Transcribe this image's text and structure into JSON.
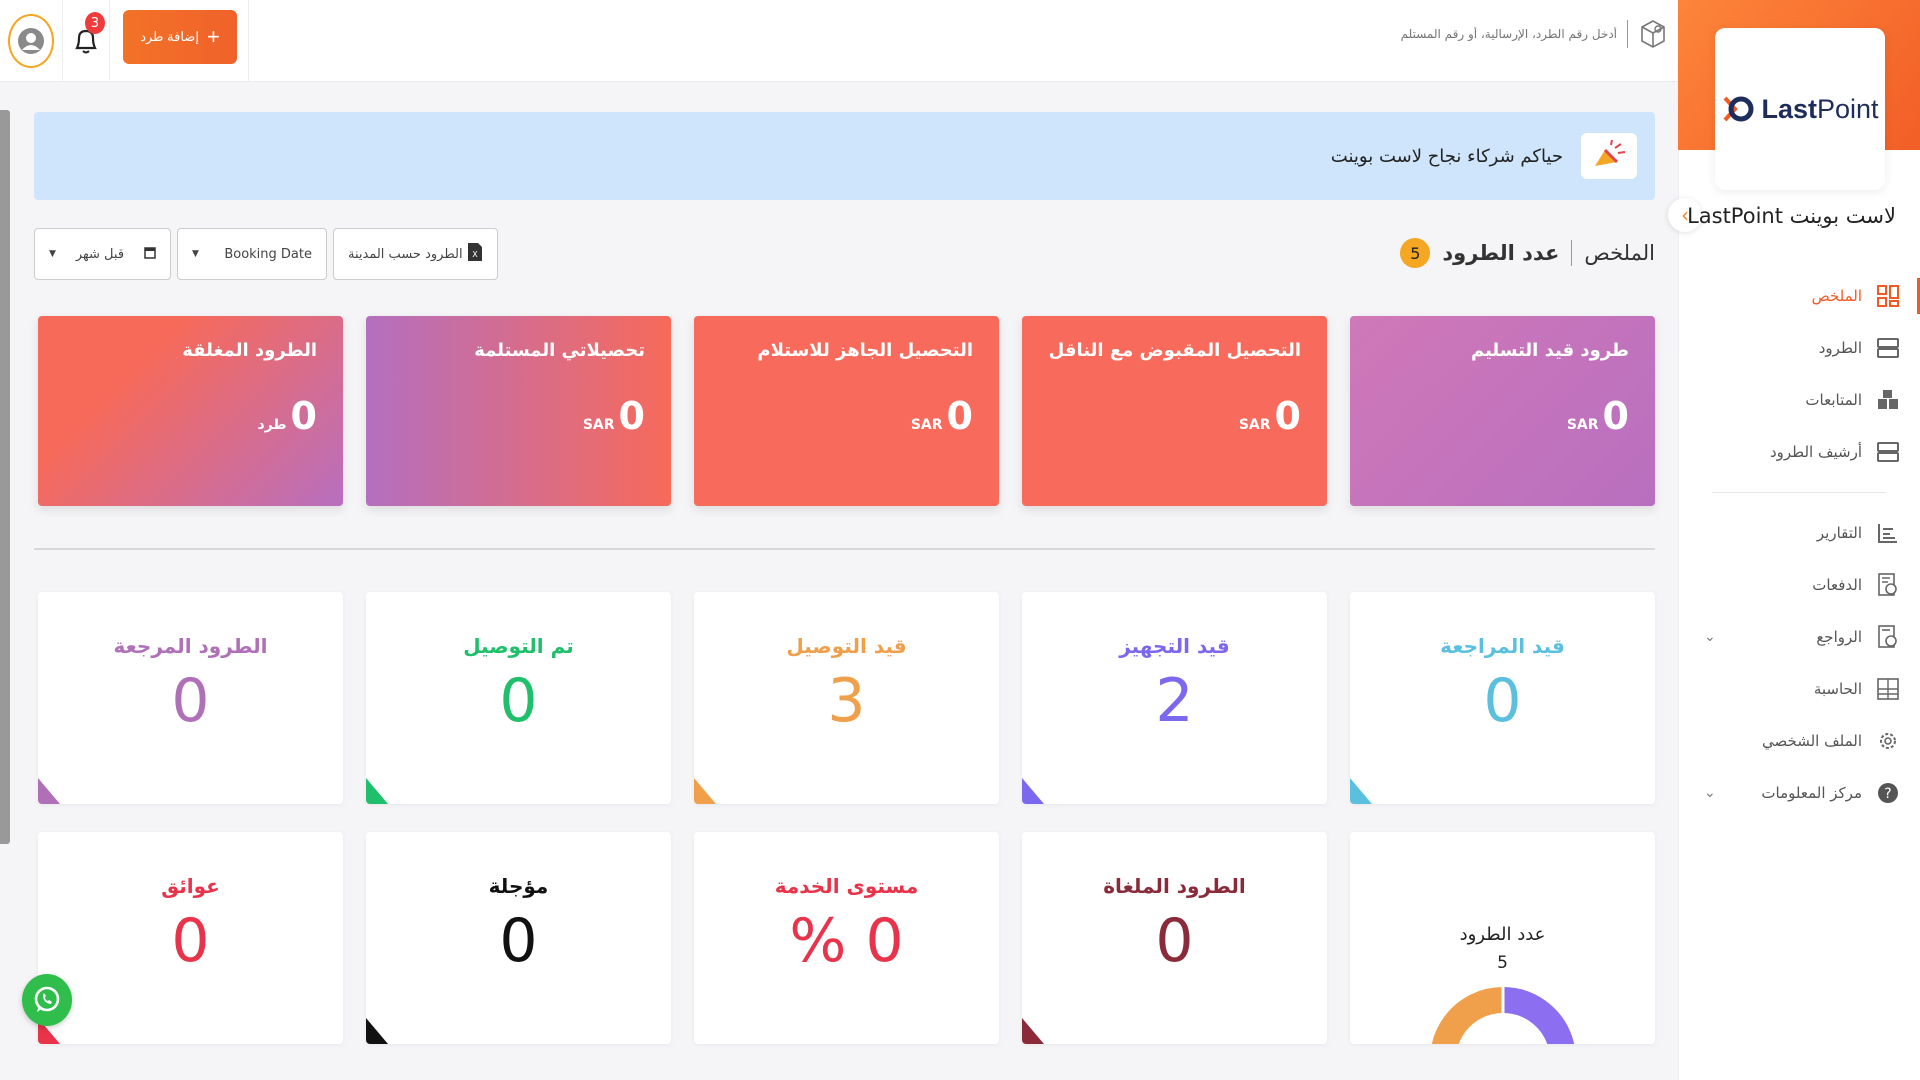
{
  "brand": {
    "logo_text_bold": "Last",
    "logo_text_light": "Point",
    "name": "لاست بوينت LastPoint"
  },
  "header": {
    "search_placeholder": "أدخل رقم الطرد، الإرسالية، أو رقم المستلم",
    "add_button": "إضافة طرد",
    "notifications_count": "3"
  },
  "sidebar": {
    "items": [
      {
        "label": "الملخص",
        "icon": "dashboard-icon",
        "active": true
      },
      {
        "label": "الطرود",
        "icon": "parcels-icon"
      },
      {
        "label": "المتابعات",
        "icon": "followups-icon"
      },
      {
        "label": "أرشيف الطرود",
        "icon": "archive-icon"
      },
      {
        "label": "التقارير",
        "icon": "reports-icon"
      },
      {
        "label": "الدفعات",
        "icon": "payments-icon"
      },
      {
        "label": "الرواجع",
        "icon": "returns-icon",
        "expandable": true
      },
      {
        "label": "الحاسبة",
        "icon": "calculator-icon"
      },
      {
        "label": "الملف الشخصي",
        "icon": "gear-icon"
      },
      {
        "label": "مركز المعلومات",
        "icon": "help-icon",
        "expandable": true
      }
    ]
  },
  "banner": {
    "text": "حياكم شركاء نجاح لاست بوينت"
  },
  "summary": {
    "title": "الملخص",
    "count_label": "عدد الطرود",
    "count": "5"
  },
  "filters": {
    "city": "الطرود حسب المدينة",
    "date_type": "Booking Date",
    "range": "قبل شهر"
  },
  "colors": {
    "orange": "#f15a24",
    "gradient_purple": "#b86fbf",
    "red": "#f86a5b"
  },
  "gradient_cards": [
    {
      "title": "طرود قيد التسليم",
      "value": "0",
      "unit": "SAR",
      "style": "purple"
    },
    {
      "title": "التحصيل المقبوض مع الناقل",
      "value": "0",
      "unit": "SAR",
      "style": "red"
    },
    {
      "title": "التحصيل الجاهز للاستلام",
      "value": "0",
      "unit": "SAR",
      "style": "red"
    },
    {
      "title": "تحصيلاتي المستلمة",
      "value": "0",
      "unit": "SAR",
      "style": "mix-l"
    },
    {
      "title": "الطرود المغلقة",
      "value": "0",
      "unit": "طرد",
      "style": "mix-r"
    }
  ],
  "stats": [
    {
      "title": "قيد المراجعة",
      "value": "0",
      "color": "#5bc0de"
    },
    {
      "title": "قيد التجهيز",
      "value": "2",
      "color": "#7b68ee"
    },
    {
      "title": "قيد التوصيل",
      "value": "3",
      "color": "#f0a04b"
    },
    {
      "title": "تم التوصيل",
      "value": "0",
      "color": "#1fbf6b"
    },
    {
      "title": "الطرود المرجعة",
      "value": "0",
      "color": "#b070b8"
    },
    {
      "title": "الطرود الملغاة",
      "value": "0",
      "color": "#8b2b3a"
    },
    {
      "title": "مستوى الخدمة",
      "value": "0 %",
      "color": "#e8334a"
    },
    {
      "title": "مؤجلة",
      "value": "0",
      "color": "#111111"
    },
    {
      "title": "عوائق",
      "value": "0",
      "color": "#e8334a"
    }
  ],
  "donut": {
    "label": "عدد الطرود",
    "total": "5",
    "segments": [
      {
        "value": 2,
        "color": "#8c6ff0"
      },
      {
        "value": 3,
        "color": "#f0a04b"
      }
    ]
  }
}
